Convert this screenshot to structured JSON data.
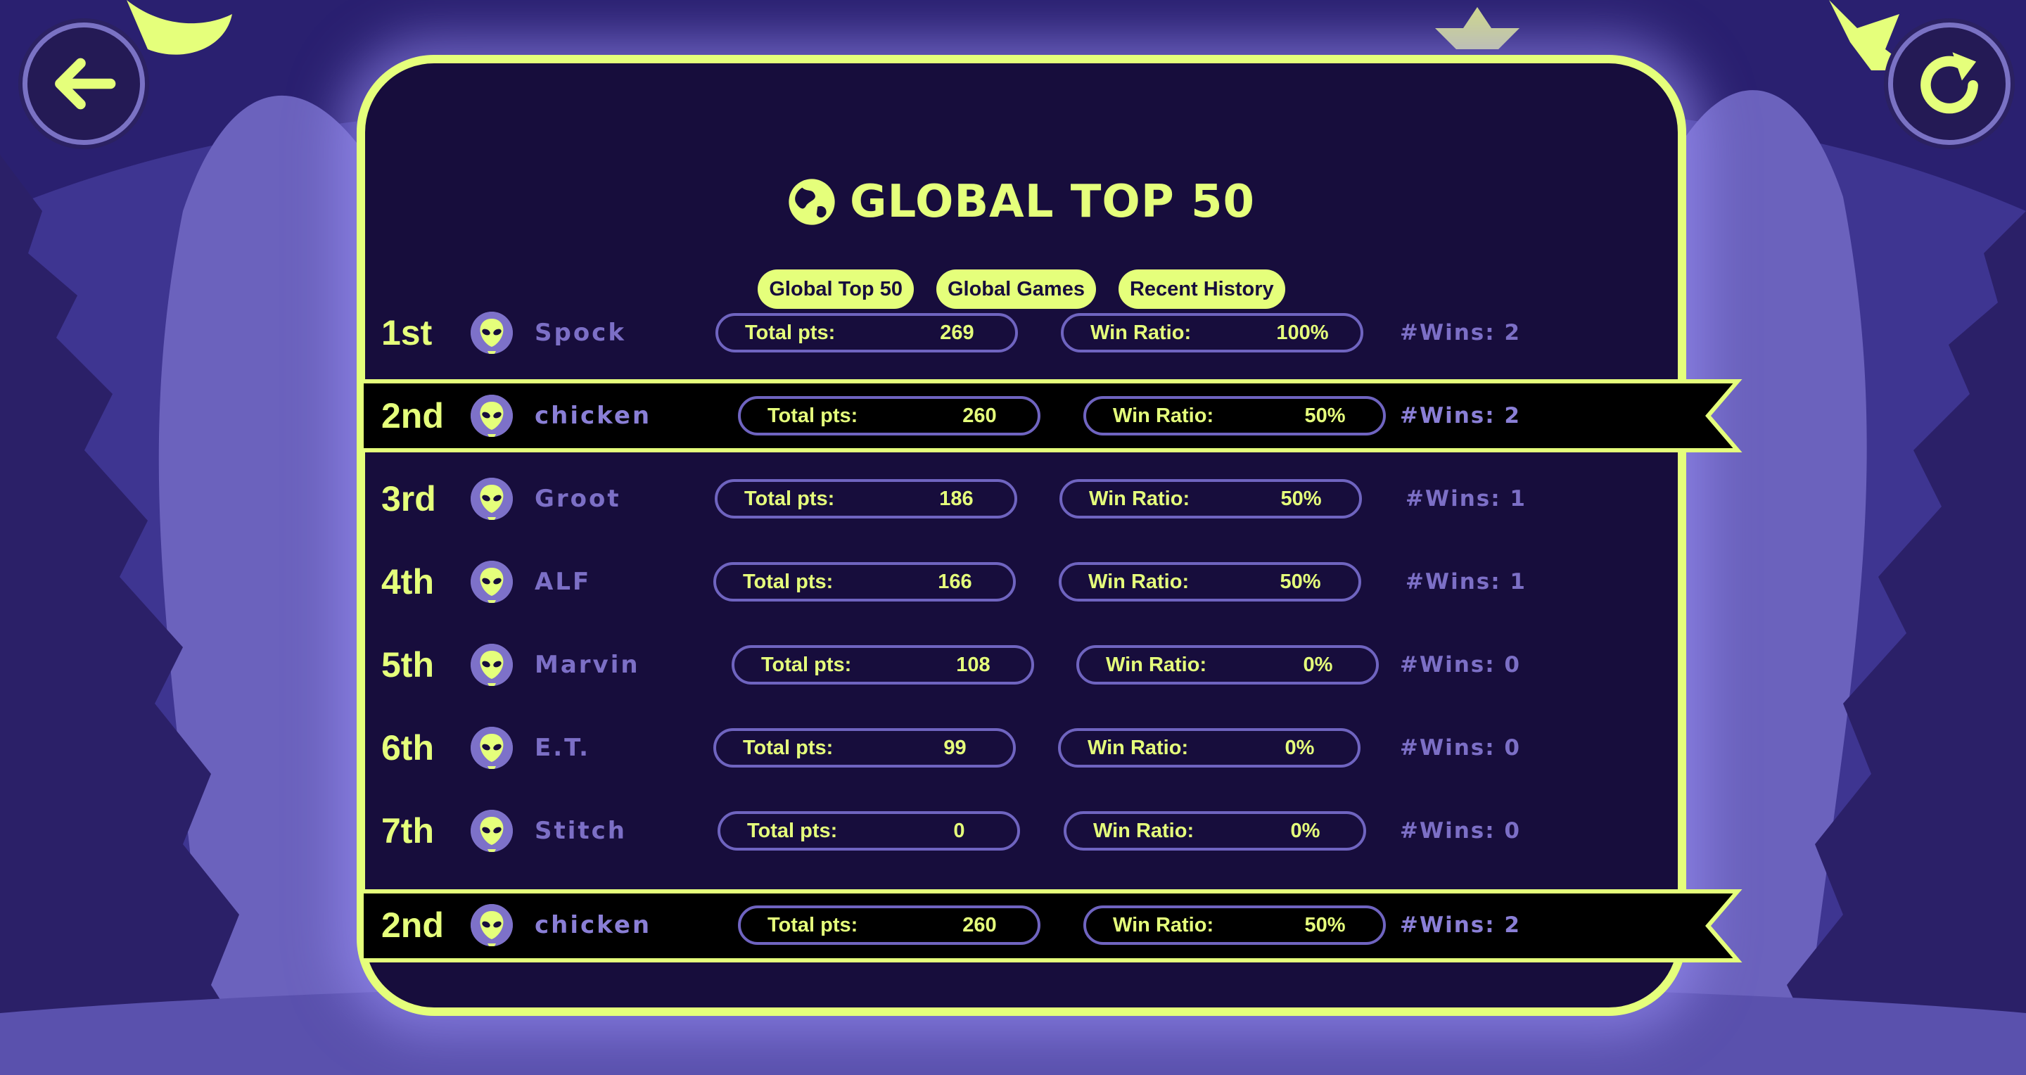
{
  "window": {
    "title": "GLOBAL TOP 50"
  },
  "tabs": [
    "Global Top 50",
    "Global Games",
    "Recent History"
  ],
  "labels": {
    "total_pts": "Total pts:",
    "win_ratio": "Win Ratio:"
  },
  "rows": [
    {
      "rank": "1st",
      "name": "Spock",
      "total": "269",
      "ratio": "100%",
      "wins": "#Wins: 2",
      "highlight": false
    },
    {
      "rank": "2nd",
      "name": "chicken",
      "total": "260",
      "ratio": "50%",
      "wins": "#Wins: 2",
      "highlight": true
    },
    {
      "rank": "3rd",
      "name": "Groot",
      "total": "186",
      "ratio": "50%",
      "wins": "#Wins: 1",
      "highlight": false
    },
    {
      "rank": "4th",
      "name": "ALF",
      "total": "166",
      "ratio": "50%",
      "wins": "#Wins: 1",
      "highlight": false
    },
    {
      "rank": "5th",
      "name": "Marvin",
      "total": "108",
      "ratio": "0%",
      "wins": "#Wins: 0",
      "highlight": false
    },
    {
      "rank": "6th",
      "name": "E.T.",
      "total": "99",
      "ratio": "0%",
      "wins": "#Wins: 0",
      "highlight": false
    },
    {
      "rank": "7th",
      "name": "Stitch",
      "total": "0",
      "ratio": "0%",
      "wins": "#Wins: 0",
      "highlight": false
    }
  ],
  "current_player": {
    "rank": "2nd",
    "name": "chicken",
    "total": "260",
    "ratio": "50%",
    "wins": "#Wins: 2"
  },
  "icons": {
    "back": "arrow-left-icon",
    "refresh": "refresh-icon",
    "title": "globe-icon",
    "avatar": "alien-avatar-icon"
  },
  "colors": {
    "accent": "#e5ff7b",
    "panel": "#170d3c",
    "background": "#3e3591",
    "muted": "#7c6fc6"
  }
}
